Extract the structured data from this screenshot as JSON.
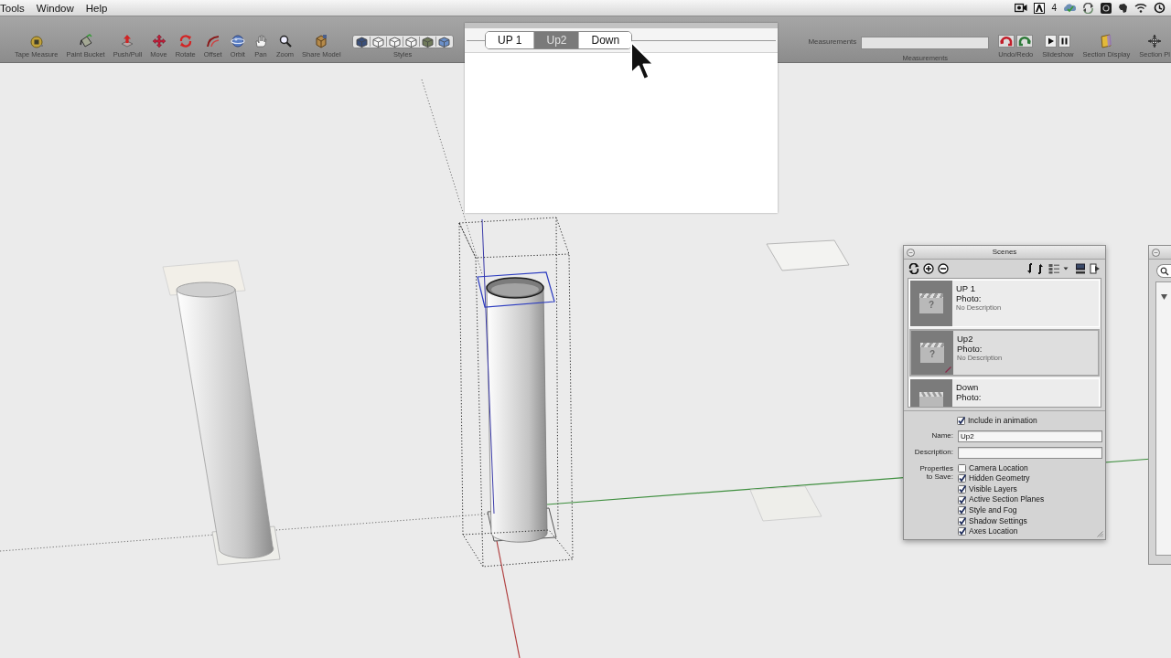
{
  "menu_bar": {
    "menus": [
      "Tools",
      "Window",
      "Help"
    ],
    "status_count": "4"
  },
  "toolbar": {
    "tools": [
      {
        "label": "Tape Measure"
      },
      {
        "label": "Paint Bucket"
      },
      {
        "label": "Push/Pull"
      },
      {
        "label": "Move"
      },
      {
        "label": "Rotate"
      },
      {
        "label": "Offset"
      },
      {
        "label": "Orbit"
      },
      {
        "label": "Pan"
      },
      {
        "label": "Zoom"
      },
      {
        "label": "Share Model"
      }
    ],
    "styles": {
      "label": "Styles"
    },
    "measurements": {
      "label": "Measurements",
      "caption": "Measurements"
    },
    "right_tools": [
      {
        "label": "Undo/Redo"
      },
      {
        "label": "Slideshow"
      },
      {
        "label": "Section Display"
      },
      {
        "label": "Section Pl"
      }
    ]
  },
  "scene_tabs": [
    {
      "label": "UP 1",
      "selected": false
    },
    {
      "label": "Up2",
      "selected": true
    },
    {
      "label": "Down",
      "selected": false
    }
  ],
  "scenes_panel": {
    "title": "Scenes",
    "scenes": [
      {
        "name": "UP 1",
        "photo": "Photo:",
        "description": "No Description",
        "placeholder_mark": "?",
        "selected": false,
        "modified": false
      },
      {
        "name": "Up2",
        "photo": "Photo:",
        "description": "No Description",
        "placeholder_mark": "?",
        "selected": true,
        "modified": true
      },
      {
        "name": "Down",
        "photo": "Photo:",
        "selected": false,
        "modified": false
      }
    ],
    "include_in_animation": {
      "label": "Include in animation",
      "checked": true
    },
    "name_field": {
      "label": "Name:",
      "value": "Up2"
    },
    "description_field": {
      "label": "Description:"
    },
    "properties": {
      "label": "Properties to Save:",
      "items": [
        {
          "label": "Camera Location",
          "checked": false
        },
        {
          "label": "Hidden Geometry",
          "checked": true
        },
        {
          "label": "Visible Layers",
          "checked": true
        },
        {
          "label": "Active Section Planes",
          "checked": true
        },
        {
          "label": "Style and Fog",
          "checked": true
        },
        {
          "label": "Shadow Settings",
          "checked": true
        },
        {
          "label": "Axes Location",
          "checked": true
        }
      ]
    }
  }
}
